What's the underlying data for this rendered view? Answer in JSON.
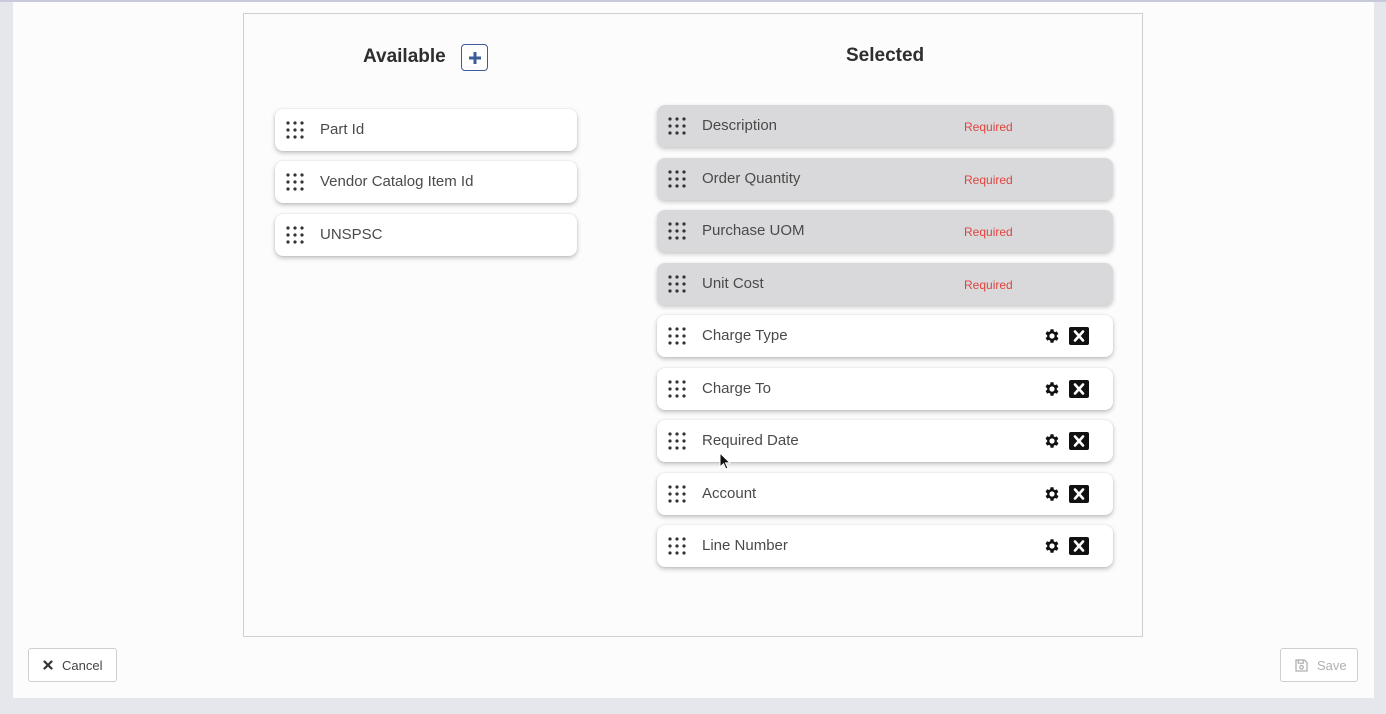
{
  "available": {
    "title": "Available",
    "items": [
      {
        "label": "Part Id"
      },
      {
        "label": "Vendor Catalog Item Id"
      },
      {
        "label": "UNSPSC"
      }
    ]
  },
  "selected": {
    "title": "Selected",
    "items": [
      {
        "label": "Description",
        "status": "Required"
      },
      {
        "label": "Order Quantity",
        "status": "Required"
      },
      {
        "label": "Purchase UOM",
        "status": "Required"
      },
      {
        "label": "Unit Cost",
        "status": "Required"
      },
      {
        "label": "Charge Type"
      },
      {
        "label": "Charge To"
      },
      {
        "label": "Required Date"
      },
      {
        "label": "Account"
      },
      {
        "label": "Line Number"
      }
    ]
  },
  "footer": {
    "cancel_label": "Cancel",
    "save_label": "Save"
  },
  "colors": {
    "accent": "#3b5c97",
    "required": "#e0443e",
    "required_card_bg": "#d9d9db"
  },
  "icons": {
    "add": "plus-square-icon",
    "grip": "drag-handle-icon",
    "settings": "gear-icon",
    "remove": "close-square-icon",
    "cancel": "close-icon",
    "save": "floppy-disk-icon"
  }
}
